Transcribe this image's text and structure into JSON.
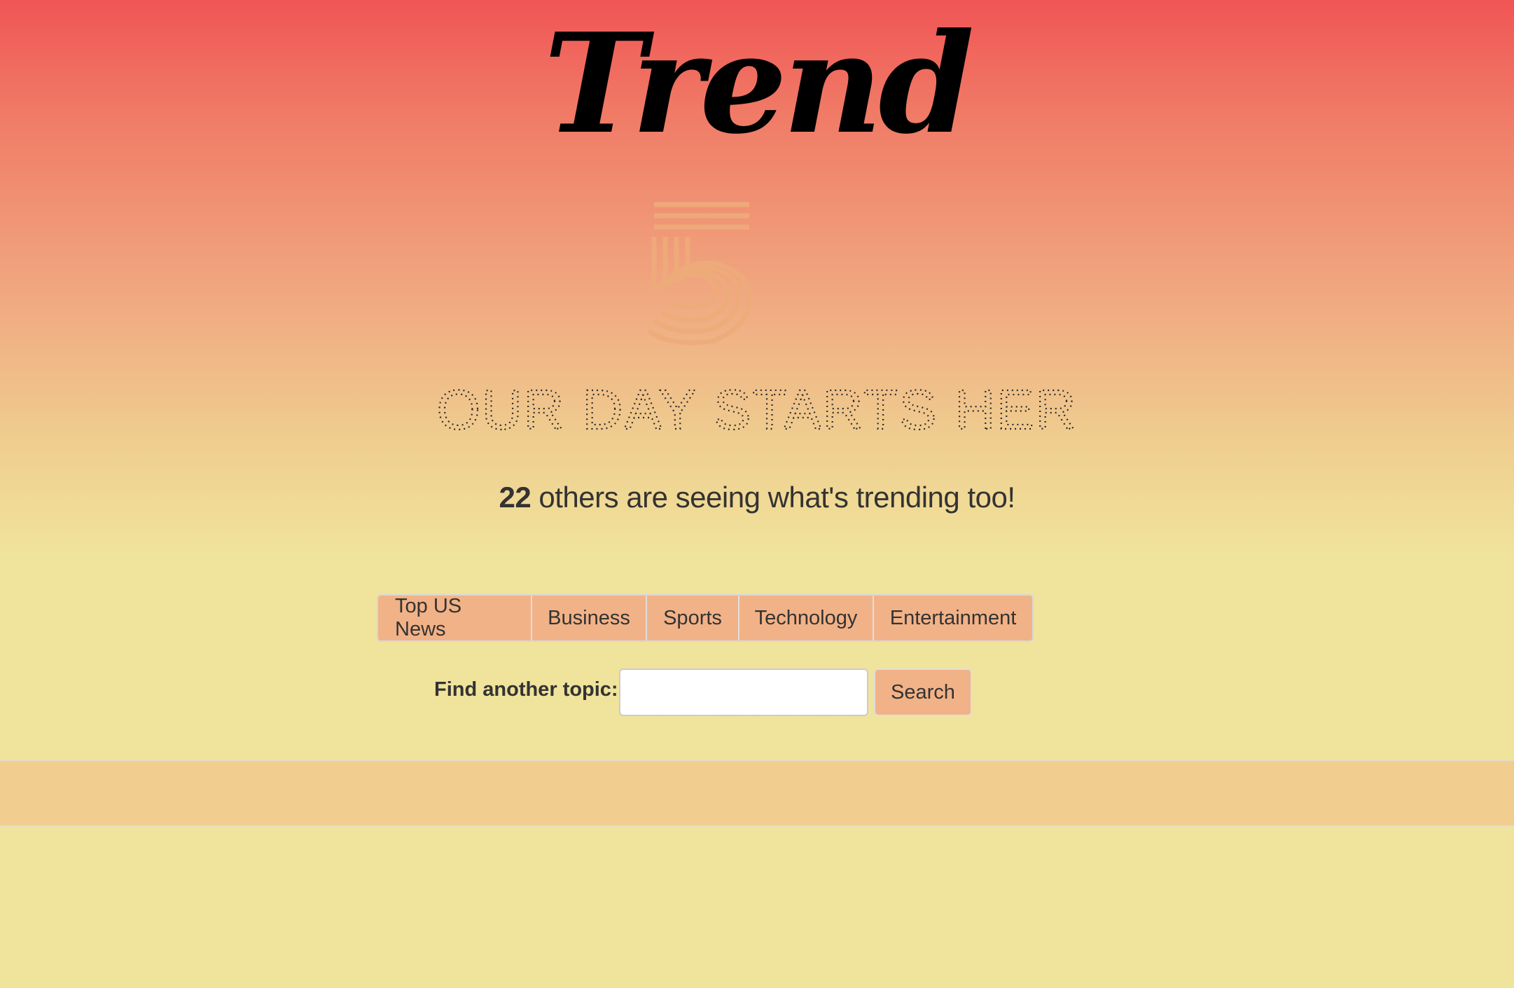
{
  "header": {
    "logo_text": "Trend",
    "tagline": "YOUR DAY STARTS HERE"
  },
  "viewers": {
    "count": "22",
    "text": " others are seeing what's trending too!"
  },
  "topics": [
    {
      "label": "Top US News"
    },
    {
      "label": "Business"
    },
    {
      "label": "Sports"
    },
    {
      "label": "Technology"
    },
    {
      "label": "Entertainment"
    }
  ],
  "search": {
    "label": "Find another topic:",
    "value": "",
    "placeholder": "",
    "button_label": "Search"
  },
  "colors": {
    "background_top": "#f05555",
    "background_bottom": "#f0e49c",
    "button_fill": "#f2b287",
    "footer_band": "#f1cd90",
    "logo_mark": "#eeac7a"
  },
  "icons": {
    "logo_mark": "five-logo-icon"
  }
}
